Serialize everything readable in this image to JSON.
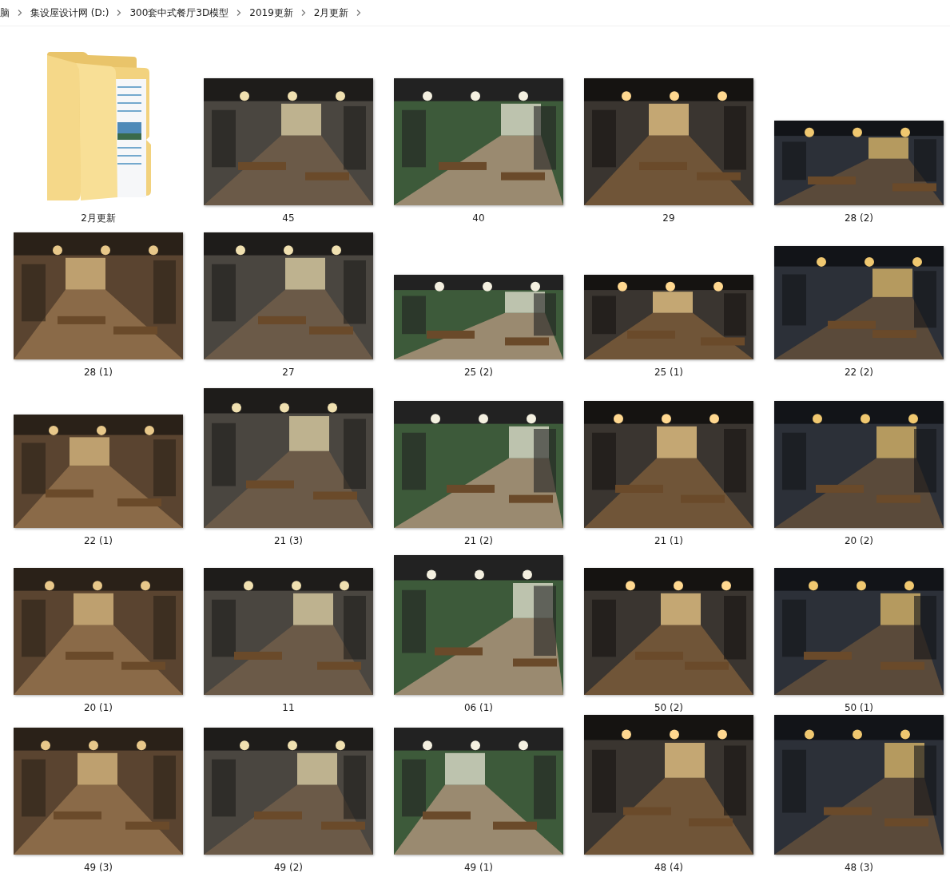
{
  "breadcrumb": [
    "脑",
    "集设屋设计网 (D:)",
    "300套中式餐厅3D模型",
    "2019更新",
    "2月更新"
  ],
  "items": [
    {
      "label": "2月更新",
      "kind": "folder"
    },
    {
      "label": "45"
    },
    {
      "label": "40"
    },
    {
      "label": "29"
    },
    {
      "label": "28 (2)",
      "kind": "wide"
    },
    {
      "label": "28 (1)"
    },
    {
      "label": "27"
    },
    {
      "label": "25 (2)",
      "kind": "wide"
    },
    {
      "label": "25 (1)",
      "kind": "wide"
    },
    {
      "label": "22 (2)",
      "kind": "medium"
    },
    {
      "label": "22 (1)",
      "kind": "medium"
    },
    {
      "label": "21 (3)",
      "kind": "tall"
    },
    {
      "label": "21 (2)"
    },
    {
      "label": "21 (1)"
    },
    {
      "label": "20 (2)"
    },
    {
      "label": "20 (1)"
    },
    {
      "label": "11"
    },
    {
      "label": "06 (1)",
      "kind": "tall"
    },
    {
      "label": "50 (2)"
    },
    {
      "label": "50 (1)"
    },
    {
      "label": "49 (3)"
    },
    {
      "label": "49 (2)"
    },
    {
      "label": "49 (1)"
    },
    {
      "label": "48 (4)",
      "kind": "tall"
    },
    {
      "label": "48 (3)",
      "kind": "tall"
    }
  ]
}
